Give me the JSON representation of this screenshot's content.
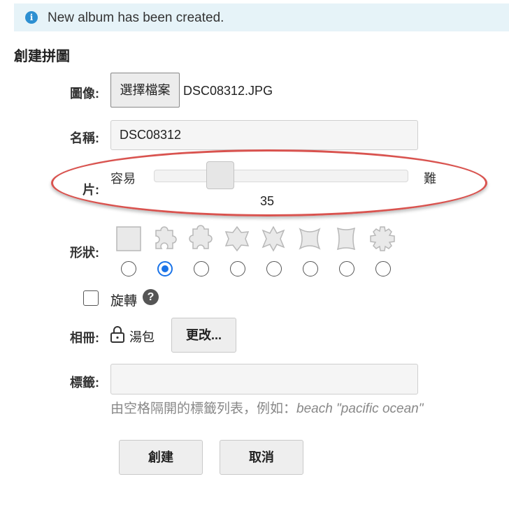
{
  "notice": {
    "icon": "info-icon",
    "message": "New album has been created."
  },
  "page_title": "創建拼圖",
  "image_field": {
    "label": "圖像:",
    "button_label": "選擇檔案",
    "file_name": "DSC08312.JPG"
  },
  "name_field": {
    "label": "名稱:",
    "value": "DSC08312"
  },
  "pieces_field": {
    "label": "片:",
    "min_label": "容易",
    "max_label": "難",
    "value": "35",
    "level_fraction": 0.23
  },
  "shape_field": {
    "label": "形狀:",
    "options": [
      {
        "icon": "square-piece-icon",
        "selected": false
      },
      {
        "icon": "jigsaw-piece-icon",
        "selected": true
      },
      {
        "icon": "jigsaw-piece-vertical-icon",
        "selected": false
      },
      {
        "icon": "star-piece-icon",
        "selected": false
      },
      {
        "icon": "star-piece-alt-icon",
        "selected": false
      },
      {
        "icon": "curved-piece-icon",
        "selected": false
      },
      {
        "icon": "wavy-piece-icon",
        "selected": false
      },
      {
        "icon": "gear-piece-icon",
        "selected": false
      }
    ]
  },
  "rotate_field": {
    "label": "旋轉",
    "checked": false,
    "help_icon": "help-icon"
  },
  "album_field": {
    "label": "相冊:",
    "icon": "lock-icon",
    "album_name": "湯包",
    "change_button": "更改..."
  },
  "tags_field": {
    "label": "標籤:",
    "value": "",
    "hint_prefix": "由空格隔開的標籤列表，例如：",
    "hint_example": "beach \"pacific ocean\""
  },
  "actions": {
    "create_button": "創建",
    "cancel_button": "取消"
  },
  "colors": {
    "notice_bg": "#e6f3f8",
    "info_blue": "#2d8fd1",
    "highlight_oval": "#d9534f",
    "radio_selected": "#1a73e8"
  }
}
